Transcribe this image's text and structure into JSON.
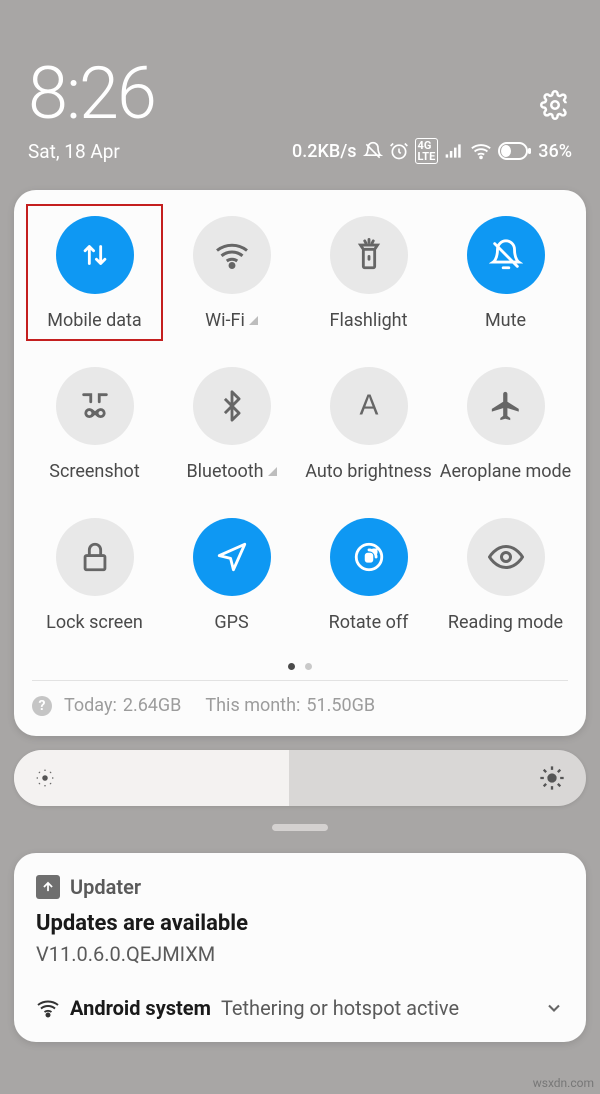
{
  "header": {
    "time": "8:26",
    "date": "Sat, 18 Apr",
    "net_speed": "0.2KB/s",
    "battery_pct": "36%"
  },
  "tiles": [
    {
      "label": "Mobile data",
      "on": true,
      "icon": "data",
      "expandable": false,
      "highlight": true
    },
    {
      "label": "Wi-Fi",
      "on": false,
      "icon": "wifi",
      "expandable": true
    },
    {
      "label": "Flashlight",
      "on": false,
      "icon": "flashlight",
      "expandable": false
    },
    {
      "label": "Mute",
      "on": true,
      "icon": "mute",
      "expandable": false
    },
    {
      "label": "Screenshot",
      "on": false,
      "icon": "screenshot",
      "expandable": false
    },
    {
      "label": "Bluetooth",
      "on": false,
      "icon": "bluetooth",
      "expandable": true
    },
    {
      "label": "Auto brightness",
      "on": false,
      "icon": "auto-bright",
      "expandable": false
    },
    {
      "label": "Aeroplane mode",
      "on": false,
      "icon": "airplane",
      "expandable": false
    },
    {
      "label": "Lock screen",
      "on": false,
      "icon": "lock",
      "expandable": false
    },
    {
      "label": "GPS",
      "on": true,
      "icon": "gps",
      "expandable": false
    },
    {
      "label": "Rotate off",
      "on": true,
      "icon": "rotate-off",
      "expandable": false
    },
    {
      "label": "Reading mode",
      "on": false,
      "icon": "eye",
      "expandable": false
    }
  ],
  "pager": {
    "pages": 2,
    "active": 0
  },
  "usage": {
    "today_label": "Today:",
    "today_value": "2.64GB",
    "month_label": "This month:",
    "month_value": "51.50GB"
  },
  "brightness": {
    "level_pct": 48
  },
  "notifications": [
    {
      "app": "Updater",
      "title": "Updates are available",
      "body": "V11.0.6.0.QEJMIXM"
    },
    {
      "app": "Android system",
      "title": "Tethering or hotspot active"
    }
  ],
  "watermark": "wsxdn.com"
}
